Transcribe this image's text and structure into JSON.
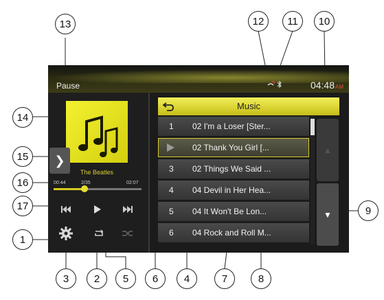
{
  "status": {
    "state": "Pause",
    "clock": "04:48",
    "ampm": "AM"
  },
  "player": {
    "artist": "The Beatles",
    "elapsed": "00:44",
    "track_counter": "2/35",
    "duration": "02:07",
    "progress_fraction": 0.35
  },
  "playlist": {
    "title": "Music",
    "rows": [
      {
        "num": "1",
        "name": "02 I'm a Loser [Ster...",
        "selected": false
      },
      {
        "num": "",
        "name": "02 Thank You Girl [...",
        "selected": true
      },
      {
        "num": "3",
        "name": "02 Things We Said ...",
        "selected": false
      },
      {
        "num": "4",
        "name": "04 Devil in Her Hea...",
        "selected": false
      },
      {
        "num": "5",
        "name": "04 It Won't Be Lon...",
        "selected": false
      },
      {
        "num": "6",
        "name": "04 Rock and Roll M...",
        "selected": false
      }
    ]
  },
  "callouts": {
    "c1": "1",
    "c2": "2",
    "c3": "3",
    "c4": "4",
    "c5": "5",
    "c6": "6",
    "c7": "7",
    "c8": "8",
    "c9": "9",
    "c10": "10",
    "c11": "11",
    "c12": "12",
    "c13": "13",
    "c14": "14",
    "c15": "15",
    "c16": "16",
    "c17": "17"
  },
  "colors": {
    "accent": "#d8cc20",
    "header_bg": "#e8e03a",
    "screen_bg": "#1b1b1b"
  }
}
